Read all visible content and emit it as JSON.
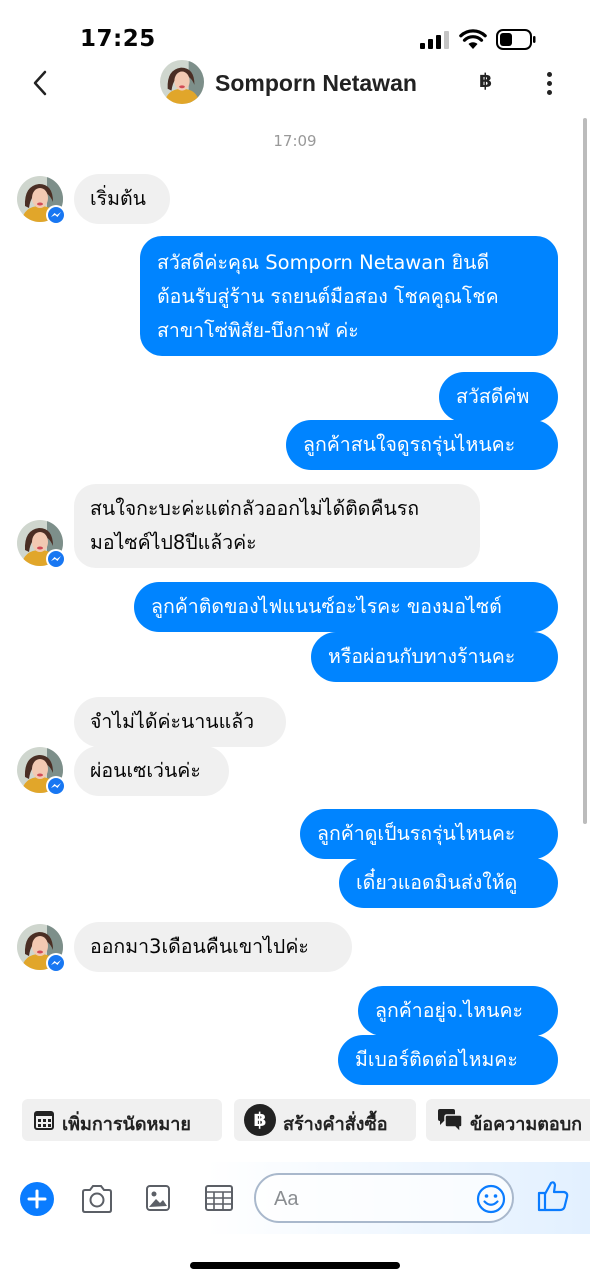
{
  "status_bar": {
    "time": "17:25"
  },
  "header": {
    "contact_name": "Somporn Netawan",
    "currency_symbol": "฿"
  },
  "timestamp": "17:09",
  "messages": [
    {
      "sender": "contact",
      "text": "เริ่มต้น"
    },
    {
      "sender": "me",
      "lines": [
        "สวัสดีค่ะคุณ Somporn Netawan ยินดี",
        "ต้อนรับสู่ร้าน รถยนต์มือสอง โชคคูณโชค",
        "สาขาโซ่พิสัย-บึงกาฬ ค่ะ"
      ]
    },
    {
      "sender": "me",
      "text": "สวัสดีค่พ"
    },
    {
      "sender": "me",
      "text": "ลูกค้าสนใจดูรถรุ่นไหนคะ"
    },
    {
      "sender": "contact",
      "lines": [
        "สนใจกะบะค่ะแต่กลัวออกไม่ได้ติดคืนรถ",
        "มอไซค์ไป8ปีแล้วค่ะ"
      ]
    },
    {
      "sender": "me",
      "text": "ลูกค้าติดของไฟแนนซ์อะไรคะ ของมอไซต์"
    },
    {
      "sender": "me",
      "text": "หรือผ่อนกับทางร้านคะ"
    },
    {
      "sender": "contact",
      "text": "จำไม่ได้ค่ะนานแล้ว"
    },
    {
      "sender": "contact",
      "text": "ผ่อนเซเว่นค่ะ"
    },
    {
      "sender": "me",
      "text": "ลูกค้าดูเป็นรถรุ่นไหนคะ"
    },
    {
      "sender": "me",
      "text": "เดี๋ยวแอดมินส่งให้ดู"
    },
    {
      "sender": "contact",
      "text": "ออกมา3เดือนคืนเขาไปค่ะ"
    },
    {
      "sender": "me",
      "text": "ลูกค้าอยู่จ.ไหนคะ"
    },
    {
      "sender": "me",
      "text": "มีเบอร์ติดต่อไหมคะ"
    }
  ],
  "quick_replies": [
    {
      "label": "เพิ่มการนัดหมาย",
      "icon": "calendar-icon"
    },
    {
      "label": "สร้างคำสั่งซื้อ",
      "icon": "baht-icon",
      "icon_glyph": "฿"
    },
    {
      "label": "ข้อความตอบก",
      "icon": "chat-bubbles-icon"
    }
  ],
  "composer": {
    "placeholder": "Aa"
  },
  "colors": {
    "accent": "#0084ff",
    "incoming_bubble": "#f0f0f0",
    "messenger_badge": "#1877f2"
  }
}
